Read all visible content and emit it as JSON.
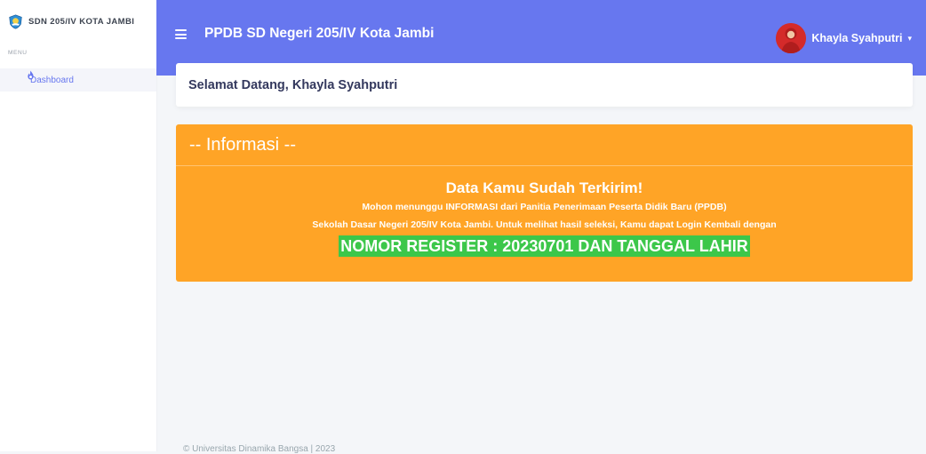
{
  "sidebar": {
    "brand": "SDN 205/IV KOTA JAMBI",
    "menu_label": "MENU",
    "items": [
      {
        "label": "Dashboard",
        "icon": "fire-icon"
      }
    ]
  },
  "navbar": {
    "title": "PPDB SD Negeri 205/IV Kota Jambi",
    "user_name": "Khayla Syahputri",
    "caret": "▾"
  },
  "welcome": {
    "text": "Selamat Datang, Khayla Syahputri"
  },
  "info": {
    "header": "-- Informasi --",
    "title": "Data Kamu Sudah Terkirim!",
    "line1_pre": "Mohon menunggu ",
    "line1_bold": "INFORMASI",
    "line1_post": " dari Panitia Penerimaan Peserta Didik Baru (PPDB)",
    "line2": "Sekolah Dasar Negeri 205/IV Kota Jambi. Untuk melihat hasil seleksi, Kamu dapat Login Kembali dengan",
    "highlight": "NOMOR REGISTER : 20230701 DAN TANGGAL LAHIR"
  },
  "footer": {
    "text": "© Universitas Dinamika Bangsa | 2023"
  },
  "colors": {
    "primary": "#6777ef",
    "warning": "#ffa426",
    "success": "#3cc74a"
  }
}
